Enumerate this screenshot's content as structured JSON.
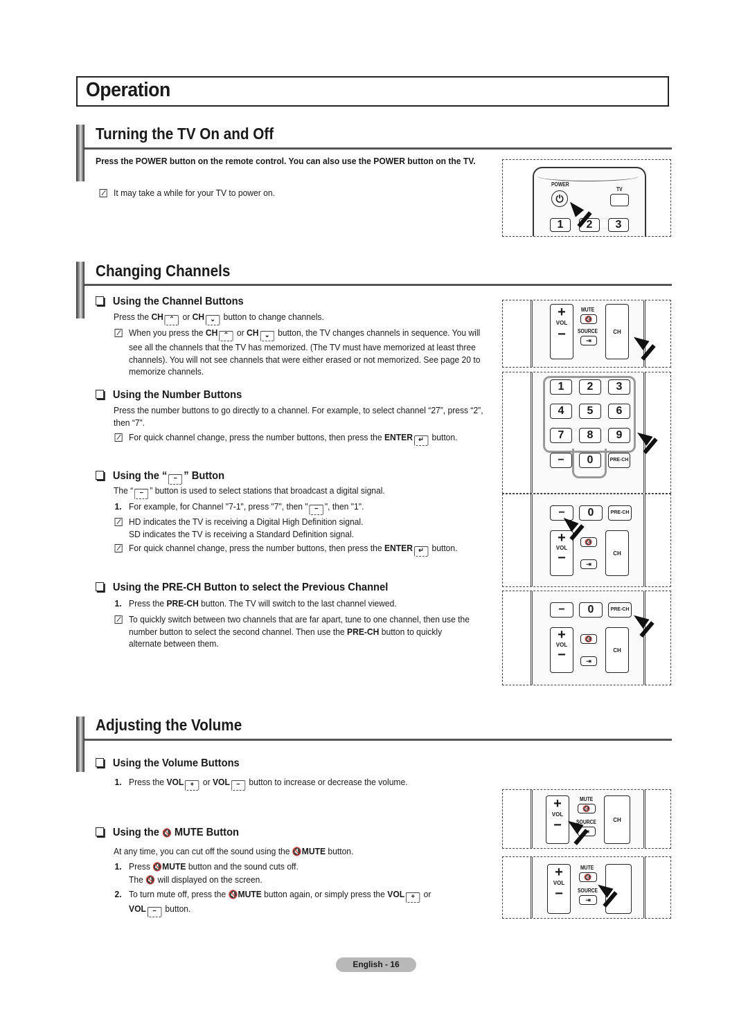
{
  "page_title": "Operation",
  "sections": {
    "power": {
      "title": "Turning the TV On and Off",
      "intro": "Press the POWER button on the remote control. You can also use the POWER button on the TV.",
      "note": "It may take a while for your TV to power on.",
      "remote_labels": {
        "power": "POWER",
        "tv": "TV",
        "keys": [
          "1",
          "2",
          "3"
        ]
      }
    },
    "channels": {
      "title": "Changing Channels",
      "channel_buttons": {
        "heading": "Using the Channel Buttons",
        "text_pre": "Press the",
        "ch": "CH",
        "or": "or",
        "text_post": "button to change channels.",
        "note_pre": "When you press the",
        "note_post": "button, the TV changes channels in sequence. You will see all the channels that the TV has memorized. (The TV must have memorized at least three channels). You will not see channels that were either erased or not memorized. See page 20 to memorize channels."
      },
      "number_buttons": {
        "heading": "Using the Number Buttons",
        "text": "Press the number buttons to go directly to a channel. For example, to select channel “27”, press “2”, then “7”.",
        "note_pre": "For quick channel change, press the number buttons, then press the",
        "note_enter": "ENTER",
        "note_post": "button."
      },
      "dash_button": {
        "heading_pre": "Using the “",
        "heading_post": "” Button",
        "text_pre": "The “",
        "text_post": "” button is used to select stations that broadcast a digital signal.",
        "step1_pre": "For example, for Channel \"7-1\", press \"7\", then \"",
        "step1_post": "\", then \"1\".",
        "note1_line1": "HD indicates the TV is receiving a Digital High Definition signal.",
        "note1_line2": "SD indicates the TV is receiving a Standard Definition signal.",
        "note2_pre": "For quick channel change, press the number buttons, then press the",
        "note2_enter": "ENTER",
        "note2_post": "button."
      },
      "prech": {
        "heading": "Using the PRE-CH Button to select the Previous Channel",
        "step1_pre": "Press the",
        "step1_bold": "PRE-CH",
        "step1_post": "button. The TV will switch to the last channel viewed.",
        "note_pre": "To quickly switch between two channels that are far apart, tune to one channel, then use the number button to select the second channel. Then use the",
        "note_bold": "PRE-CH",
        "note_post": "button to quickly alternate between them."
      }
    },
    "volume": {
      "title": "Adjusting the Volume",
      "volume_buttons": {
        "heading": "Using the Volume Buttons",
        "step1_pre": "Press the",
        "vol": "VOL",
        "or": "or",
        "step1_post": "button to increase or decrease the volume."
      },
      "mute": {
        "heading_pre": "Using the",
        "heading_post": "MUTE Button",
        "intro_pre": "At any time, you can cut off the sound using the",
        "mute": "MUTE",
        "intro_post": "button.",
        "step1_pre": "Press",
        "step1_post": "button and the sound cuts off.",
        "step1_line2_pre": "The",
        "step1_line2_post": "will displayed on the screen.",
        "step2_pre": "To turn mute off, press the",
        "step2_mid": "button again, or simply press the",
        "step2_or": "or",
        "step2_post": "button."
      }
    }
  },
  "step_numbers": [
    "1.",
    "2."
  ],
  "key_glyphs": {
    "plus": "+",
    "minus": "−",
    "up": "⌃",
    "down": "⌄",
    "mute": "🔇",
    "enter": "↵"
  },
  "remote_labels": {
    "vol": "VOL",
    "ch": "CH",
    "mute": "MUTE",
    "source": "SOURCE",
    "prech": "PRE-CH",
    "digits": [
      "1",
      "2",
      "3",
      "4",
      "5",
      "6",
      "7",
      "8",
      "9",
      "0"
    ]
  },
  "footer": "English - 16"
}
